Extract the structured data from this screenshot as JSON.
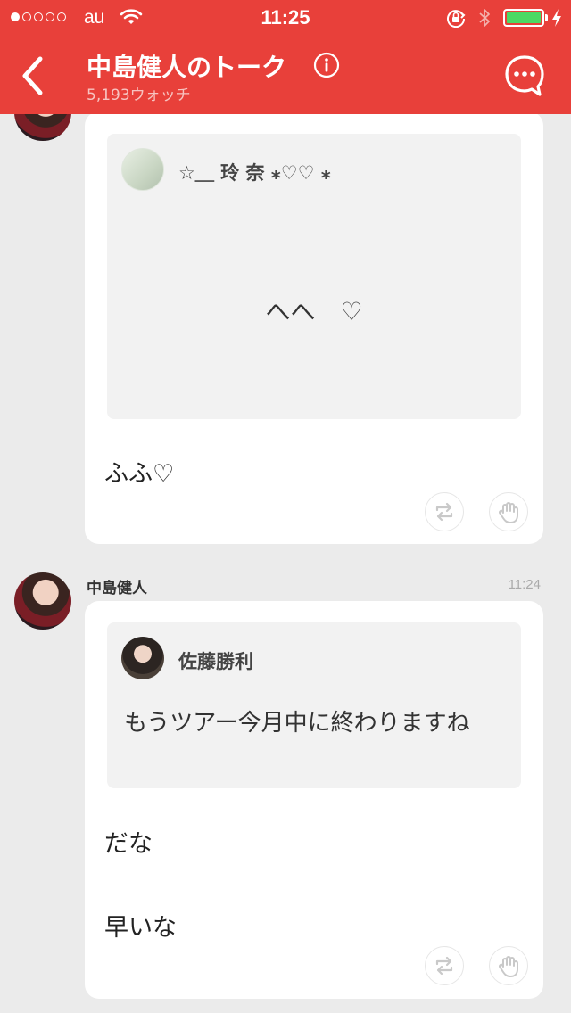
{
  "status_bar": {
    "carrier": "au",
    "time": "11:25",
    "signal_strength": 1,
    "battery_color": "#4cd964"
  },
  "header": {
    "title": "中島健人のトーク",
    "watch_count": "5,193ウォッチ",
    "background_color": "#e8403a",
    "icons": [
      "back-chevron-icon",
      "info-icon",
      "chat-bubble-icon"
    ]
  },
  "messages": [
    {
      "quote": {
        "author": "☆＿ 玲 奈 ⁎♡♡ ⁎",
        "text": "へへ　♡"
      },
      "lines": [
        "ふふ♡"
      ],
      "actions": [
        "retweet-icon",
        "hand-icon"
      ]
    },
    {
      "sender": "中島健人",
      "time": "11:24",
      "quote": {
        "author": "佐藤勝利",
        "text": "もうツアー今月中に終わりますね"
      },
      "lines": [
        "だな",
        "早いな"
      ],
      "actions": [
        "retweet-icon",
        "hand-icon"
      ]
    }
  ]
}
